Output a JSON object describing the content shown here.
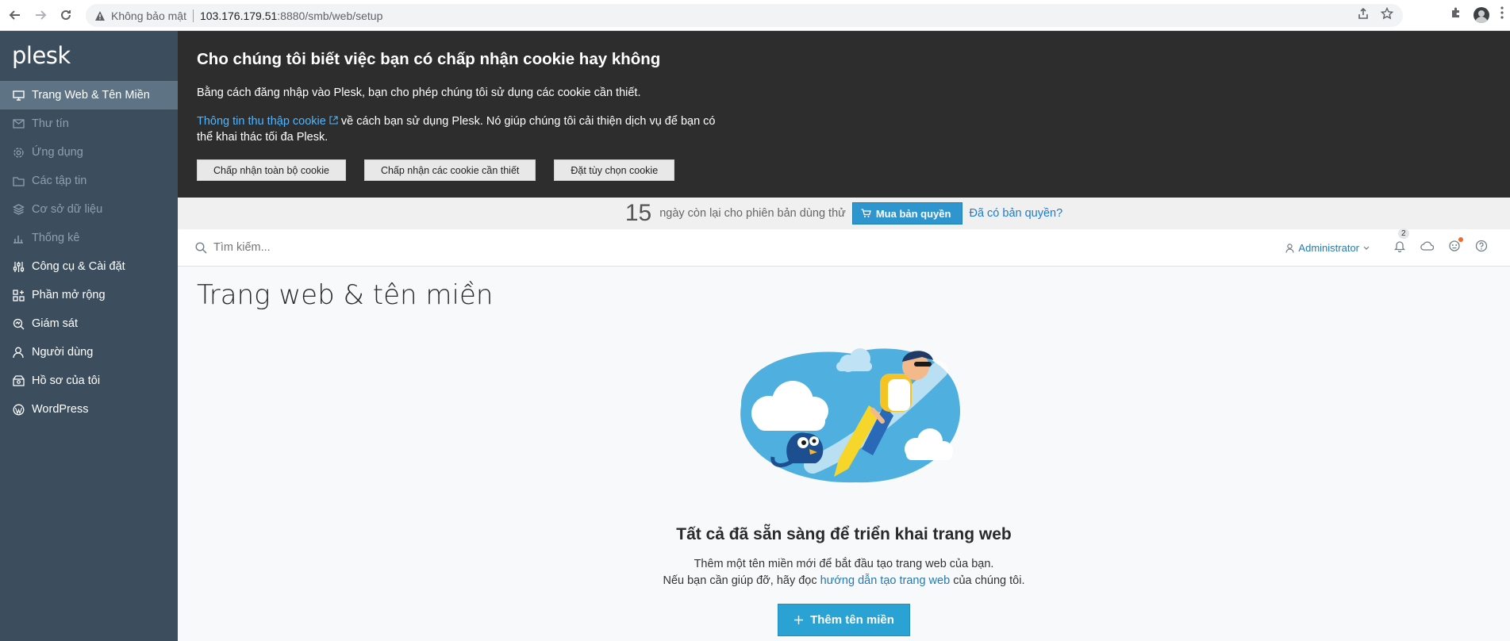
{
  "browser": {
    "security_label": "Không bảo mật",
    "url_host": "103.176.179.51",
    "url_path": ":8880/smb/web/setup"
  },
  "sidebar": {
    "logo": "plesk",
    "items": [
      {
        "label": "Trang Web & Tên Miền",
        "icon": "monitor-icon"
      },
      {
        "label": "Thư tín",
        "icon": "mail-icon"
      },
      {
        "label": "Ứng dụng",
        "icon": "gear-icon"
      },
      {
        "label": "Các tập tin",
        "icon": "folder-icon"
      },
      {
        "label": "Cơ sở dữ liệu",
        "icon": "database-icon"
      },
      {
        "label": "Thống kê",
        "icon": "chart-icon"
      },
      {
        "label": "Công cụ & Cài đặt",
        "icon": "sliders-icon"
      },
      {
        "label": "Phần mở rộng",
        "icon": "extensions-icon"
      },
      {
        "label": "Giám sát",
        "icon": "monitoring-icon"
      },
      {
        "label": "Người dùng",
        "icon": "user-icon"
      },
      {
        "label": "Hồ sơ của tôi",
        "icon": "profile-icon"
      },
      {
        "label": "WordPress",
        "icon": "wordpress-icon"
      }
    ]
  },
  "cookie": {
    "title": "Cho chúng tôi biết việc bạn có chấp nhận cookie hay không",
    "text1": "Bằng cách đăng nhập vào Plesk, bạn cho phép chúng tôi sử dụng các cookie cần thiết.",
    "link": "Thông tin thu thập cookie",
    "text2": " về cách bạn sử dụng Plesk. Nó giúp chúng tôi cải thiện dịch vụ để bạn có thể khai thác tối đa Plesk.",
    "btn_accept_all": "Chấp nhận toàn bộ cookie",
    "btn_accept_required": "Chấp nhận các cookie cần thiết",
    "btn_customize": "Đặt tùy chọn cookie"
  },
  "trial": {
    "days": "15",
    "text": "ngày còn lại cho phiên bản dùng thử",
    "buy": "Mua bản quyền",
    "have_license": "Đã có bản quyền?"
  },
  "topbar": {
    "search_placeholder": "Tìm kiếm...",
    "user": "Administrator",
    "notifications_count": "2"
  },
  "main": {
    "title": "Trang web & tên miền",
    "ready_title": "Tất cả đã sẵn sàng để triển khai trang web",
    "line1": "Thêm một tên miền mới để bắt đầu tạo trang web của bạn.",
    "line2_pre": "Nếu bạn cần giúp đỡ, hãy đọc ",
    "line2_link": "hướng dẫn tạo trang web",
    "line2_post": " của chúng tôi.",
    "add_button": "Thêm tên miền"
  }
}
